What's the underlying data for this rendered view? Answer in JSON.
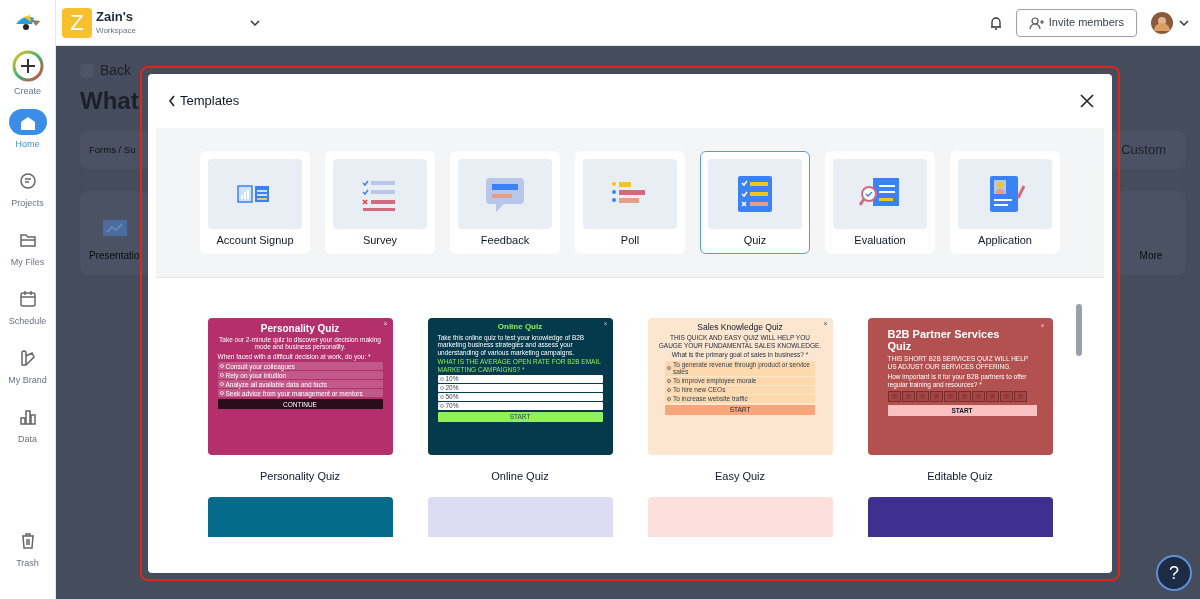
{
  "sidebar": {
    "items": [
      {
        "label": "Create",
        "kind": "create",
        "selected": false
      },
      {
        "label": "Home",
        "kind": "home",
        "selected": true
      },
      {
        "label": "Projects",
        "kind": "projects",
        "selected": false
      },
      {
        "label": "My Files",
        "kind": "files",
        "selected": false
      },
      {
        "label": "Schedule",
        "kind": "schedule",
        "selected": false
      },
      {
        "label": "My Brand",
        "kind": "brand",
        "selected": false
      },
      {
        "label": "Data",
        "kind": "data",
        "selected": false
      }
    ],
    "footer_item": {
      "label": "Trash",
      "kind": "trash",
      "selected": false
    }
  },
  "topbar": {
    "workspace": {
      "initial": "Z",
      "name": "Zain's",
      "subtitle": "Workspace"
    },
    "invite_button": "Invite members"
  },
  "background_page": {
    "back": "Back",
    "heading": "What",
    "tabs": [
      "Forms / Su",
      "Custom"
    ],
    "tiles": [
      "Presentatio",
      "More"
    ]
  },
  "modal": {
    "title": "Templates",
    "categories": [
      {
        "label": "Account Signup",
        "kind": "signup",
        "selected": false
      },
      {
        "label": "Survey",
        "kind": "survey",
        "selected": false
      },
      {
        "label": "Feedback",
        "kind": "feedback",
        "selected": false
      },
      {
        "label": "Poll",
        "kind": "poll",
        "selected": false
      },
      {
        "label": "Quiz",
        "kind": "quiz",
        "selected": true
      },
      {
        "label": "Evaluation",
        "kind": "evaluation",
        "selected": false
      },
      {
        "label": "Application",
        "kind": "application",
        "selected": false
      }
    ],
    "templates": [
      {
        "label": "Personality Quiz",
        "kind": "options",
        "color": "#b3306c",
        "preview": {
          "close": "×",
          "title": "Personality Quiz",
          "description": "Take our 2-minute quiz to discover your decision making mode and business personality.",
          "question": "When faced with a difficult decision at work, do you: *",
          "options": [
            "Consult your colleagues",
            "Rely on your intuition",
            "Analyze all available data and facts",
            "Seek advice from your management or mentors"
          ],
          "button": "CONTINUE"
        }
      },
      {
        "label": "Online Quiz",
        "kind": "options",
        "color": "#053a4d",
        "preview": {
          "close": "×",
          "title": "Online Quiz",
          "description": "Take this online quiz to test your knowledge of B2B marketing business strategies and assess your understanding of various marketing campaigns.",
          "question": "WHAT IS THE AVERAGE OPEN RATE FOR B2B EMAIL MARKETING CAMPAIGNS? *",
          "options": [
            "10%",
            "20%",
            "50%",
            "70%"
          ],
          "button": "START"
        }
      },
      {
        "label": "Easy Quiz",
        "kind": "options",
        "color": "#fde6cf",
        "preview": {
          "close": "×",
          "title": "Sales Knowledge Quiz",
          "description": "THIS QUICK AND EASY QUIZ WILL HELP YOU GAUGE YOUR FUNDAMENTAL SALES KNOWLEDGE.",
          "question": "What is the primary goal of sales in business? *",
          "options": [
            "To generate revenue through product or service sales",
            "To improve employee morale",
            "To hire new CEOs",
            "To increase website traffic"
          ],
          "button": "START"
        }
      },
      {
        "label": "Editable Quiz",
        "kind": "rating",
        "color": "#b35050",
        "preview": {
          "close": "×",
          "title": "B2B Partner Services Quiz",
          "description": "THIS SHORT B2B SERVICES QUIZ WILL HELP US ADJUST OUR SERVICES OFFERING.",
          "question": "How important is it for your B2B partners to offer regular training and resources? *",
          "scale": [
            "☆",
            "☆",
            "☆",
            "☆",
            "☆",
            "☆",
            "☆",
            "☆",
            "☆",
            "☆"
          ],
          "button": "START"
        }
      },
      {
        "kind": "cut",
        "color": "#066a8a"
      },
      {
        "kind": "cut",
        "color": "#dcdcf4"
      },
      {
        "kind": "cut",
        "color": "#fde0dc"
      },
      {
        "kind": "cut",
        "color": "#3f2f8f"
      }
    ]
  },
  "help_button": "?"
}
